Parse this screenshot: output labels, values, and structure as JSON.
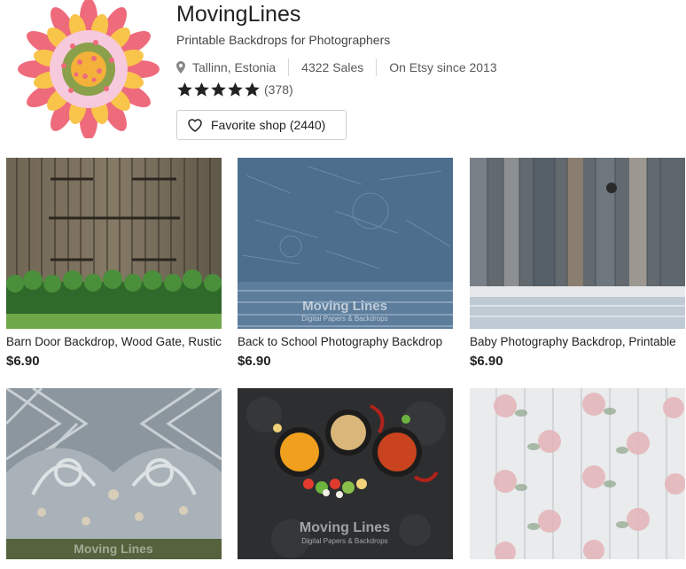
{
  "shop": {
    "name": "MovingLines",
    "tagline": "Printable Backdrops for Photographers",
    "location": "Tallinn, Estonia",
    "sales": "4322 Sales",
    "since": "On Etsy since 2013",
    "rating_stars": 5,
    "rating_count": "(378)",
    "favorite_label": "Favorite shop",
    "favorite_count": "(2440)"
  },
  "listings": [
    {
      "title": "Barn Door Backdrop, Wood Gate, Rustic",
      "price": "$6.90"
    },
    {
      "title": "Back to School Photography Backdrop",
      "price": "$6.90"
    },
    {
      "title": "Baby Photography Backdrop, Printable",
      "price": "$6.90"
    },
    {
      "title": "",
      "price": ""
    },
    {
      "title": "",
      "price": ""
    },
    {
      "title": "",
      "price": ""
    }
  ],
  "watermark": {
    "brand": "Moving Lines",
    "sub": "Digital Papers & Backdrops"
  },
  "icons": {
    "logo": "flower-logo",
    "location": "location-pin-icon",
    "star": "star-icon",
    "favorite": "heart-icon"
  },
  "colors": {
    "star": "#222222",
    "petal_pink": "#ee6b7b",
    "petal_yellow": "#f8c44a",
    "center_green": "#8aa04a"
  }
}
